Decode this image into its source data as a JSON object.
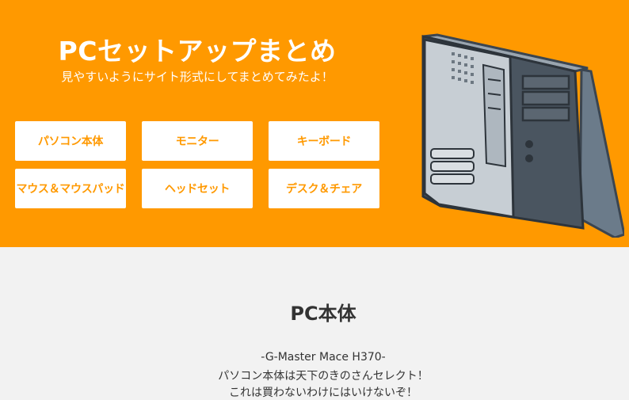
{
  "hero": {
    "title": "PCセットアップまとめ",
    "subtitle": "見やすいようにサイト形式にしてまとめてみたよ！",
    "accent_color": "#ff9900",
    "illustration": "desktop-pc-tower-illustration"
  },
  "nav": {
    "buttons": [
      {
        "label": "パソコン本体"
      },
      {
        "label": "モニター"
      },
      {
        "label": "キーボード"
      },
      {
        "label": "マウス＆マウスパッド"
      },
      {
        "label": "ヘッドセット"
      },
      {
        "label": "デスク＆チェア"
      }
    ]
  },
  "section": {
    "title": "PC本体",
    "lines": [
      "-G-Master Mace H370-",
      "パソコン本体は天下のきのさんセレクト！",
      "これは買わないわけにはいけないぞ！"
    ]
  }
}
